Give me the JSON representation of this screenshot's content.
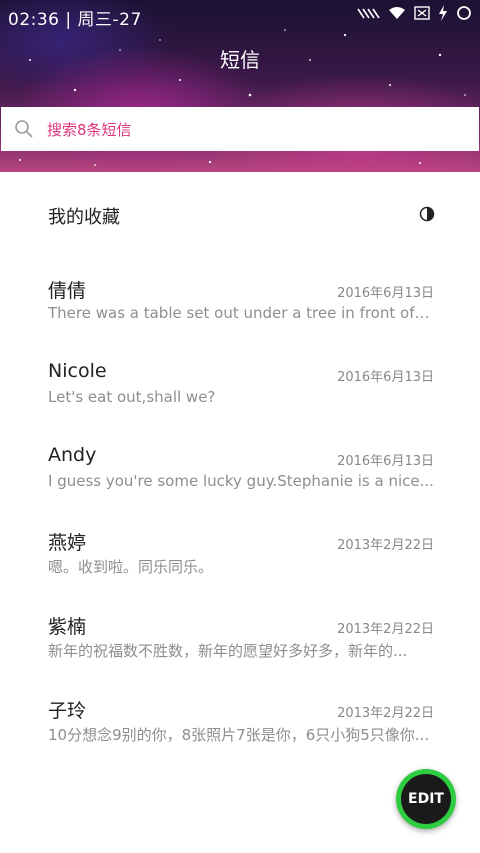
{
  "status_bar": {
    "time": "02:36 | 周三-27",
    "icons": [
      "signal-icon",
      "wifi-icon",
      "sim-off-icon",
      "charging-icon",
      "battery-ring-icon"
    ]
  },
  "header": {
    "title": "短信"
  },
  "search": {
    "placeholder": "搜索8条短信",
    "icon": "search-icon"
  },
  "favorites": {
    "label": "我的收藏",
    "icon": "half-circle-icon"
  },
  "messages": [
    {
      "name": "倩倩",
      "date": "2016年6月13日",
      "preview": "There was a table set out under a tree in front of th..."
    },
    {
      "name": "Nicole",
      "date": "2016年6月13日",
      "preview": "Let's eat out,shall we?"
    },
    {
      "name": "Andy",
      "date": "2016年6月13日",
      "preview": "I guess you're some lucky guy.Stephanie is a nice..."
    },
    {
      "name": "燕婷",
      "date": "2013年2月22日",
      "preview": "嗯。收到啦。同乐同乐。"
    },
    {
      "name": "紫楠",
      "date": "2013年2月22日",
      "preview": "新年的祝福数不胜数，新年的愿望好多好多，新年的..."
    },
    {
      "name": "子玲",
      "date": "2013年2月22日",
      "preview": "10分想念9别的你，8张照片7张是你，6只小狗5只像你..."
    }
  ],
  "fab": {
    "label": "EDIT"
  },
  "colors": {
    "accent_pink": "#e0367d",
    "fab_ring": "#2ecc40",
    "fab_bg": "#1a1a1a"
  }
}
